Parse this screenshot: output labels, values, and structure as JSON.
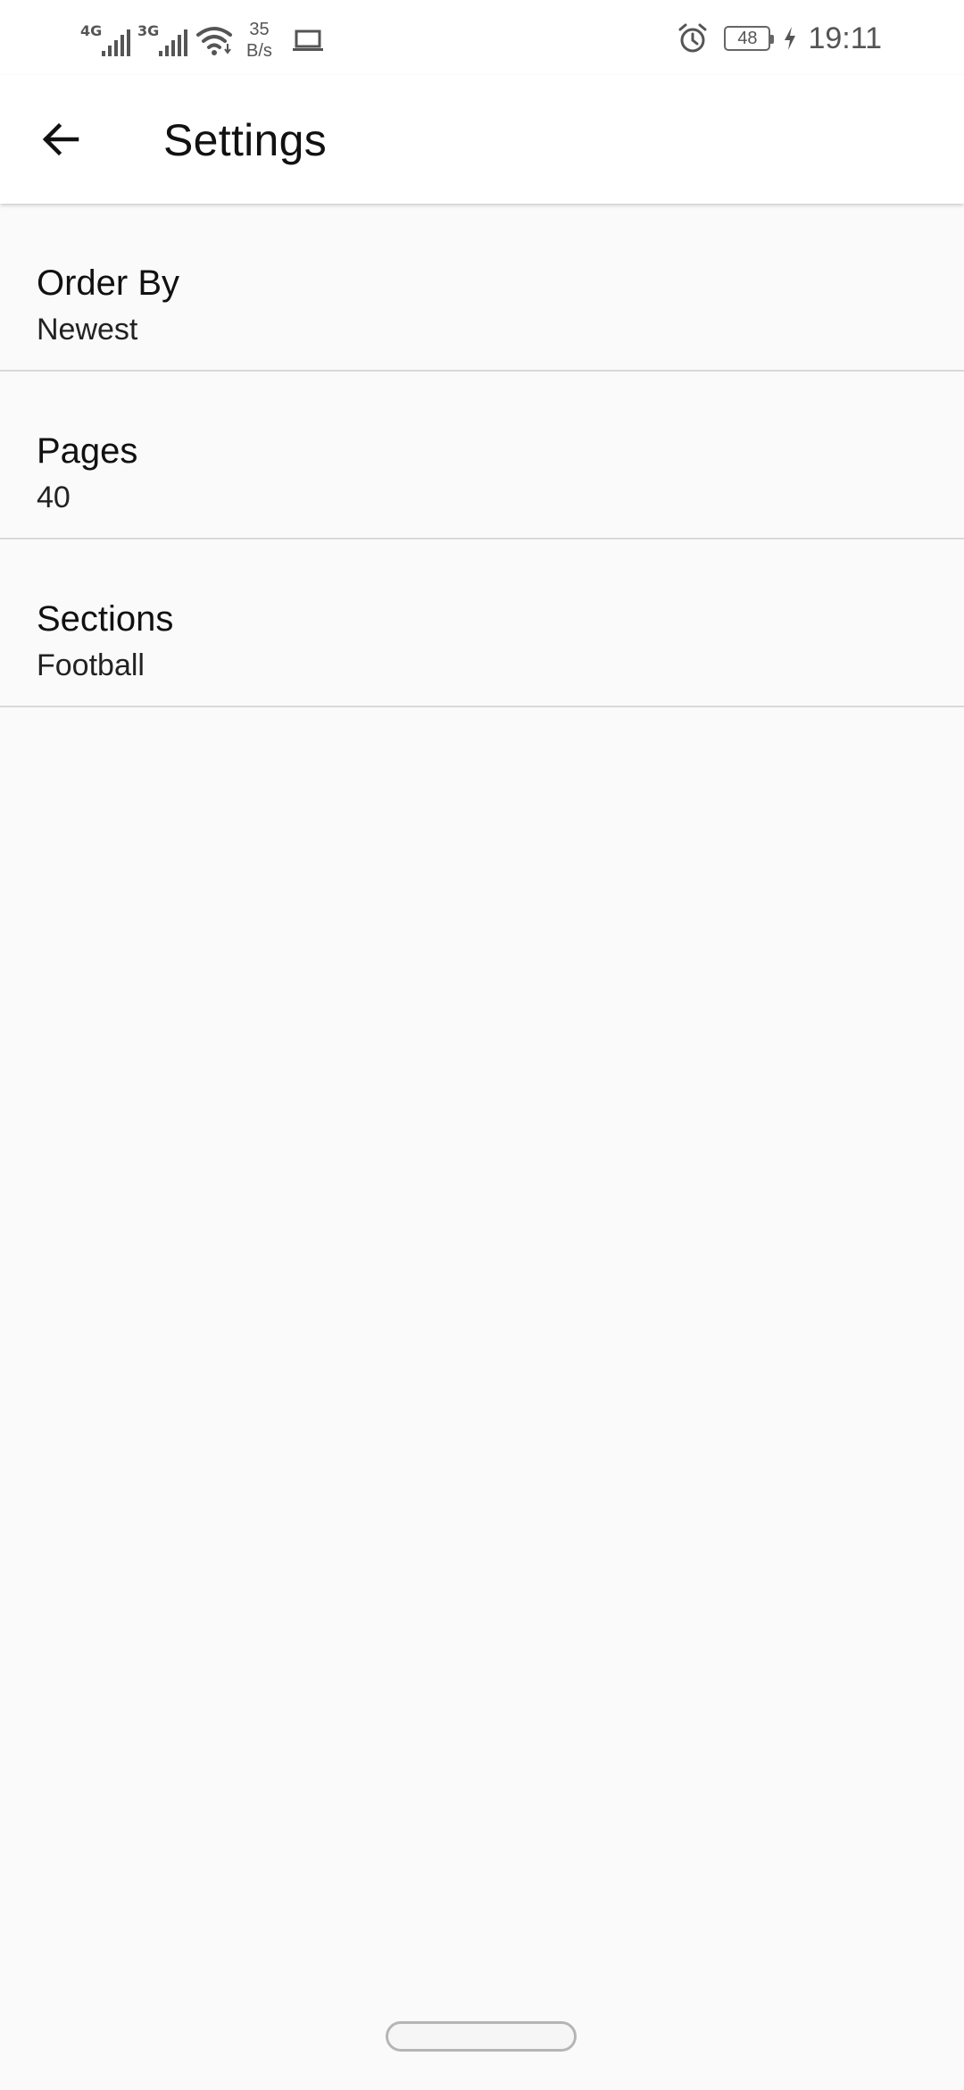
{
  "status_bar": {
    "network1": "4G",
    "network2": "3G",
    "speed_value": "35",
    "speed_unit": "B/s",
    "battery": "48",
    "time": "19:11",
    "icons": [
      "signal-icon",
      "signal-icon",
      "wifi-icon",
      "laptop-icon",
      "alarm-icon",
      "battery-icon",
      "charging-icon"
    ]
  },
  "app_bar": {
    "back_icon": "arrow-left-icon",
    "title": "Settings"
  },
  "preferences": [
    {
      "title": "Order By",
      "summary": "Newest"
    },
    {
      "title": "Pages",
      "summary": "40"
    },
    {
      "title": "Sections",
      "summary": "Football"
    }
  ],
  "colors": {
    "background": "#fafafa",
    "app_bar": "#ffffff",
    "divider": "#d9d9d9",
    "text": "#111111"
  }
}
